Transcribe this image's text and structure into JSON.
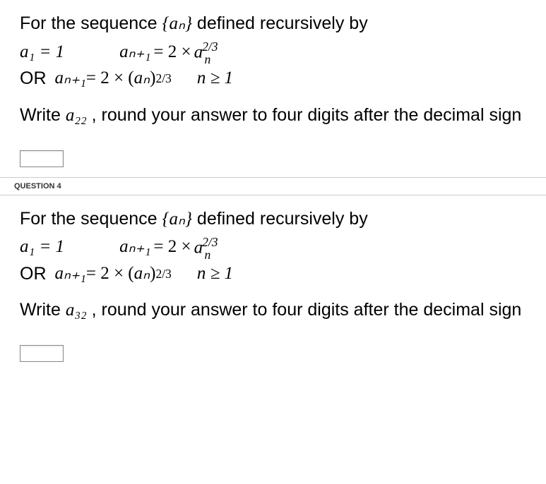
{
  "q3": {
    "line1_a": "For the sequence ",
    "line1_b": " defined recursively by",
    "seq_sym": "{aₙ}",
    "init_cond": "a₁ = 1",
    "rec1_lhs": "aₙ₊₁",
    "rec1_eq": " = 2 × ",
    "rec1_base": "a",
    "rec1_sub": "n",
    "rec1_sup": "2/3",
    "or": "OR",
    "rec2_lhs": "aₙ₊₁",
    "rec2_eq": " = 2 × (",
    "rec2_inner": "aₙ",
    "rec2_close": ")",
    "rec2_exp": "2/3",
    "cond": "n ≥ 1",
    "prompt_a": "Write ",
    "target": "a₂₂",
    "prompt_b": " , round your answer to four digits after the decimal sign"
  },
  "q4": {
    "header": "QUESTION 4",
    "line1_a": "For the sequence ",
    "line1_b": " defined recursively by",
    "seq_sym": "{aₙ}",
    "init_cond": "a₁ = 1",
    "rec1_lhs": "aₙ₊₁",
    "rec1_eq": " = 2 × ",
    "rec1_base": "a",
    "rec1_sub": "n",
    "rec1_sup": "2/3",
    "or": "OR",
    "rec2_lhs": "aₙ₊₁",
    "rec2_eq": " = 2 × (",
    "rec2_inner": "aₙ",
    "rec2_close": ")",
    "rec2_exp": "2/3",
    "cond": "n ≥ 1",
    "prompt_a": "Write ",
    "target": "a₃₂",
    "prompt_b": " , round your answer to four digits after the decimal sign"
  }
}
